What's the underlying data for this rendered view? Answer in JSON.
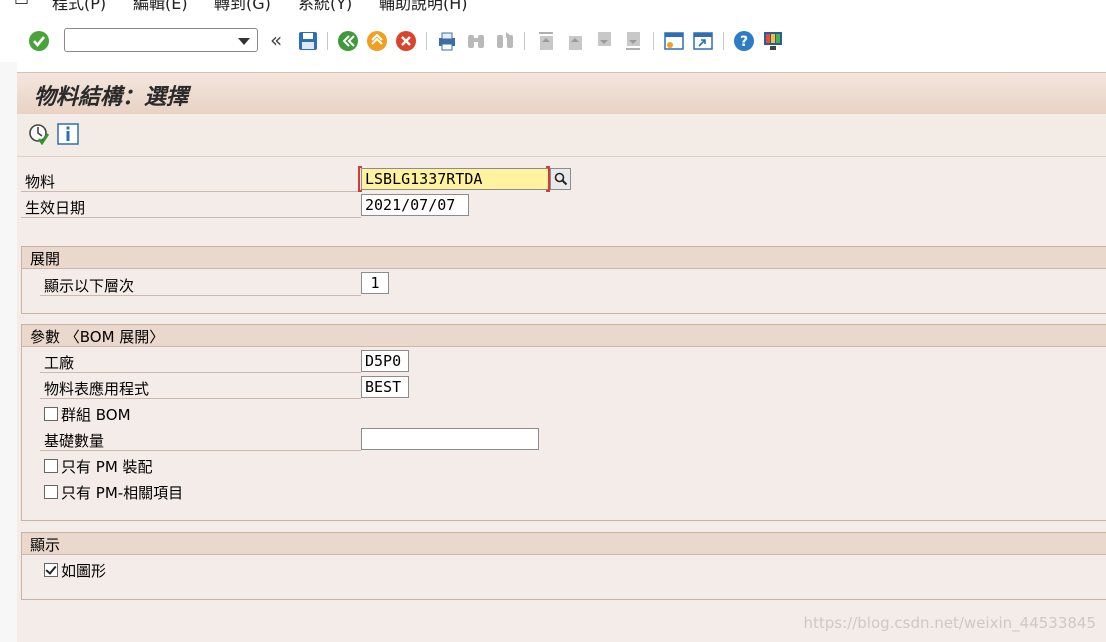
{
  "menu": {
    "items": [
      "程式(P)",
      "編輯(E)",
      "轉到(G)",
      "系統(Y)",
      "輔助說明(H)"
    ]
  },
  "toolbar": {
    "command_value": ""
  },
  "page": {
    "title": "物料結構：選擇"
  },
  "form": {
    "material_label": "物料",
    "material_value": "LSBLG1337RTDA",
    "date_label": "生效日期",
    "date_value": "2021/07/07"
  },
  "explode": {
    "title": "展開",
    "levels_label": "顯示以下層次",
    "levels_value": "1"
  },
  "params": {
    "title": "參數 〈BOM 展開〉",
    "plant_label": "工廠",
    "plant_value": "D5P0",
    "app_label": "物料表應用程式",
    "app_value": "BEST",
    "group_bom_label": "群組 BOM",
    "group_bom_checked": false,
    "base_qty_label": "基礎數量",
    "base_qty_value": "",
    "pm_assembly_label": "只有 PM 裝配",
    "pm_assembly_checked": false,
    "pm_related_label": "只有 PM-相關項目",
    "pm_related_checked": false
  },
  "display": {
    "title": "顯示",
    "graphic_label": "如圖形",
    "graphic_checked": true
  },
  "watermark": "https://blog.csdn.net/weixin_44533845"
}
